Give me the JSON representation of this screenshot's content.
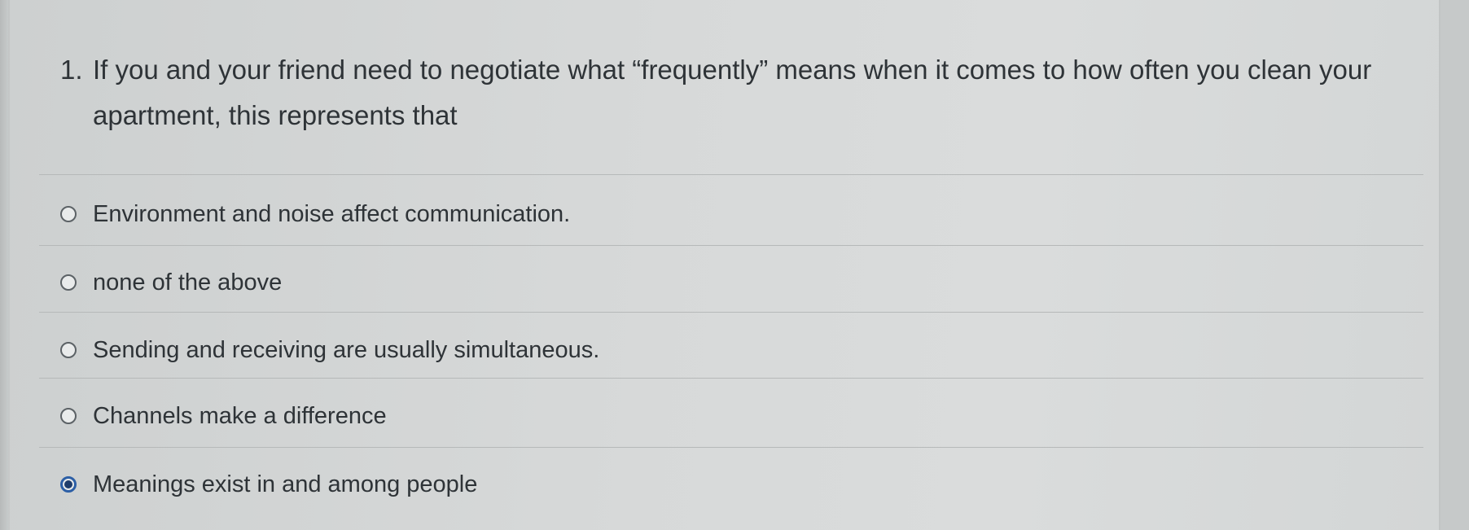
{
  "question": {
    "number": "1.",
    "text": "If you and your friend need to negotiate what “frequently” means when it comes to how often you clean your apartment, this represents that"
  },
  "options": [
    {
      "label": "Environment and noise affect communication.",
      "selected": false
    },
    {
      "label": "none of the above",
      "selected": false
    },
    {
      "label": "Sending and receiving are usually simultaneous.",
      "selected": false
    },
    {
      "label": "Channels make a difference",
      "selected": false
    },
    {
      "label": "Meanings exist in and among people",
      "selected": true
    }
  ],
  "colors": {
    "text": "#2e3337",
    "radio_border": "#5c6266",
    "radio_selected": "#2c5fa6"
  },
  "icons": {
    "unselected": "radio-unselected-icon",
    "selected": "radio-selected-icon"
  }
}
